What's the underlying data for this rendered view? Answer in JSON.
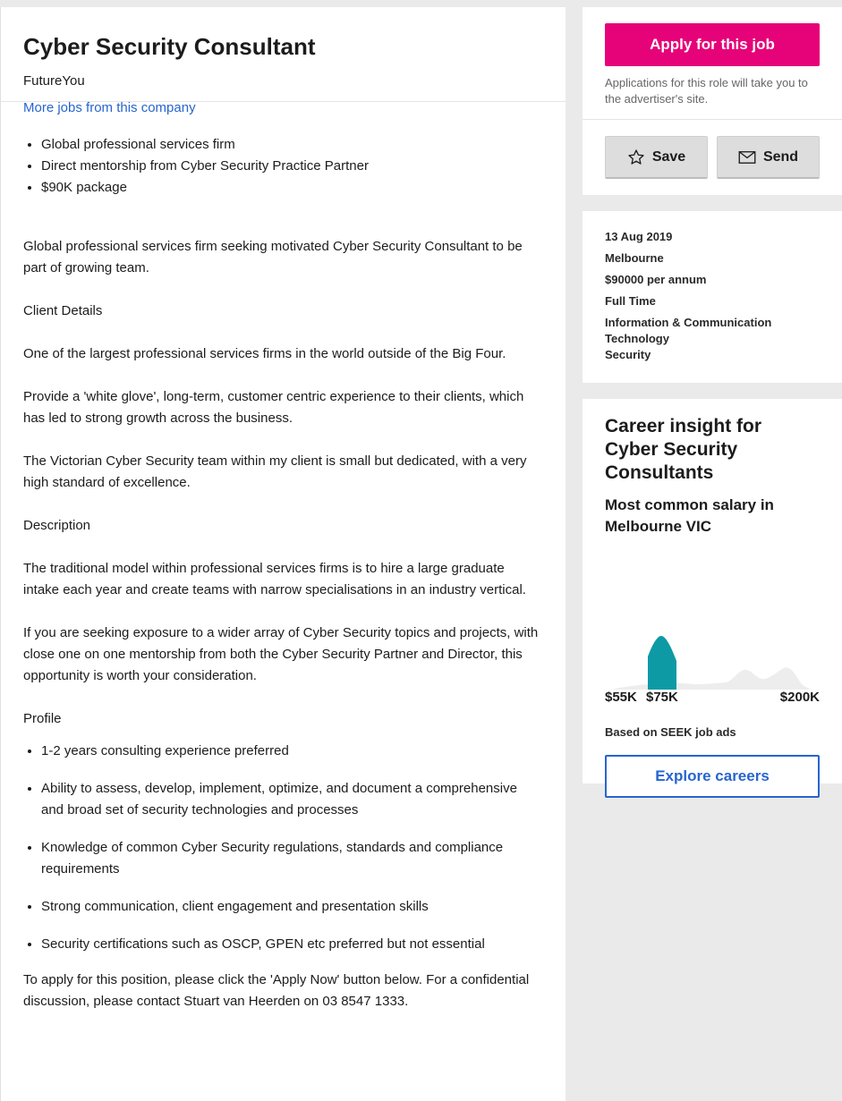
{
  "job": {
    "title": "Cyber Security Consultant",
    "company": "FutureYou",
    "more_jobs_link": "More jobs from this company"
  },
  "highlights": [
    "Global professional services firm",
    "Direct mentorship from Cyber Security Practice Partner",
    "$90K package"
  ],
  "body": {
    "intro": "Global professional services firm seeking motivated Cyber Security Consultant to be part of growing team.",
    "client_details_heading": "Client Details",
    "client_para_1": "One of the largest professional services firms in the world outside of the Big Four.",
    "client_para_2": "Provide a 'white glove', long-term, customer centric experience to their clients, which has led to strong growth across the business.",
    "client_para_3": "The Victorian Cyber Security team within my client is small but dedicated, with a very high standard of excellence.",
    "description_heading": "Description",
    "description_para_1": "The traditional model within professional services firms is to hire a large graduate intake each year and create teams with narrow specialisations in an industry vertical.",
    "description_para_2": "If you are seeking exposure to a wider array of Cyber Security topics and projects, with close one on one mentorship from both the Cyber Security Partner and Director, this opportunity is worth your consideration.",
    "profile_heading": "Profile",
    "profile_items": [
      "1-2 years consulting experience preferred",
      "Ability to assess, develop, implement, optimize, and document a comprehensive and broad set of security technologies and processes",
      "Knowledge of common Cyber Security regulations, standards and compliance requirements",
      "Strong communication, client engagement and presentation skills",
      "Security certifications such as OSCP, GPEN etc preferred but not essential"
    ],
    "apply_text": "To apply for this position, please click the 'Apply Now' button below.   For a confidential discussion, please contact Stuart van Heerden on 03 8547 1333."
  },
  "sidebar": {
    "apply_button": "Apply for this job",
    "apply_note": "Applications for this role will take you to the advertiser's site.",
    "save_button": "Save",
    "send_button": "Send",
    "meta": {
      "date": "13 Aug 2019",
      "location": "Melbourne",
      "salary": "$90000 per annum",
      "work_type": "Full Time",
      "category_1": "Information & Communication",
      "category_2": "Technology",
      "subcategory": "Security"
    },
    "insight": {
      "title": "Career insight for Cyber Security Consultants",
      "salary_heading": "Most common salary in Melbourne VIC",
      "tick_low": "$55K",
      "tick_mid": "$75K",
      "tick_high": "$200K",
      "based_on": "Based on SEEK job ads",
      "explore_button": "Explore careers",
      "highlight_color": "#0d9aa5"
    }
  }
}
